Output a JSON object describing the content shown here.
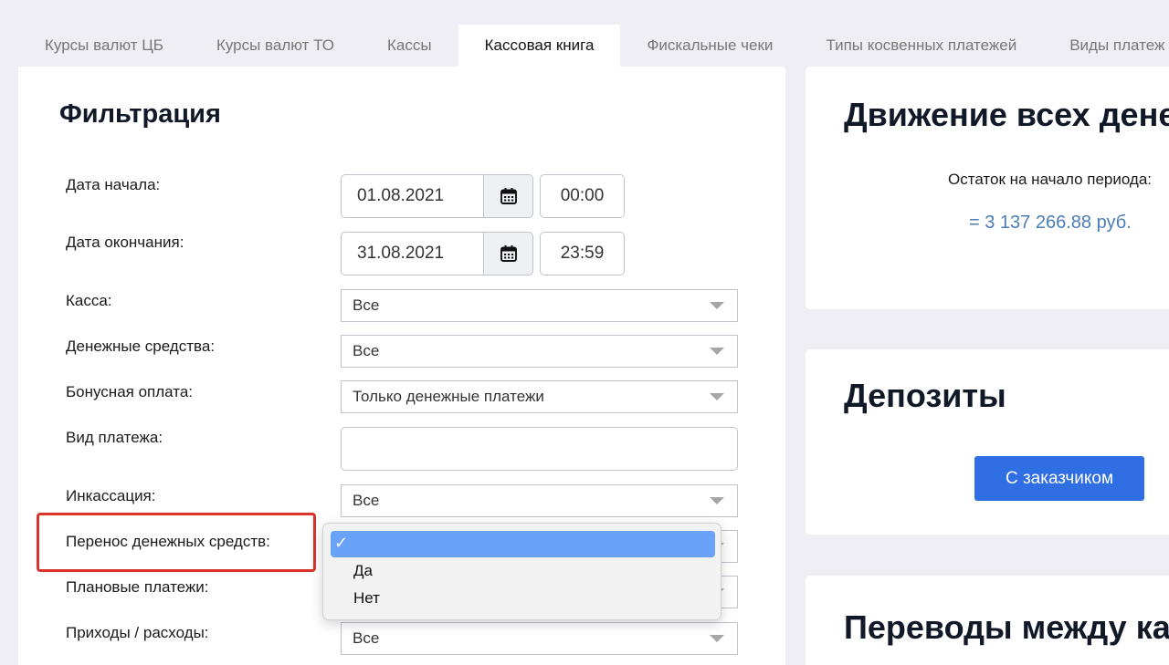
{
  "tabs": [
    "Курсы валют ЦБ",
    "Курсы валют ТО",
    "Кассы",
    "Кассовая книга",
    "Фискальные чеки",
    "Типы косвенных платежей",
    "Виды платеж"
  ],
  "filter": {
    "title": "Фильтрация",
    "start_label": "Дата начала:",
    "start_date": "01.08.2021",
    "start_time": "00:00",
    "end_label": "Дата окончания:",
    "end_date": "31.08.2021",
    "end_time": "23:59",
    "kassa_label": "Касса:",
    "kassa_value": "Все",
    "cash_label": "Денежные средства:",
    "cash_value": "Все",
    "bonus_label": "Бонусная оплата:",
    "bonus_value": "Только денежные платежи",
    "payment_type_label": "Вид платежа:",
    "payment_type_value": "",
    "incasso_label": "Инкассация:",
    "incasso_value": "Все",
    "transfer_label": "Перенос денежных средств:",
    "planned_label": "Плановые платежи:",
    "income_label": "Приходы / расходы:",
    "income_value": "Все"
  },
  "dropdown": {
    "check_mark": "✓",
    "options": [
      "",
      "Да",
      "Нет"
    ]
  },
  "movement": {
    "title": "Движение всех денег",
    "balance_label": "Остаток на начало периода:",
    "balance_value": "= 3 137 266.88 руб."
  },
  "deposits": {
    "title": "Депозиты",
    "button": "С заказчиком"
  },
  "transfers": {
    "title": "Переводы между касс"
  },
  "colors": {
    "accent_button": "#2f6fe3",
    "balance_text": "#4a7db8",
    "highlight_border": "#d9342b",
    "dropdown_selected": "#6aa2f7"
  }
}
